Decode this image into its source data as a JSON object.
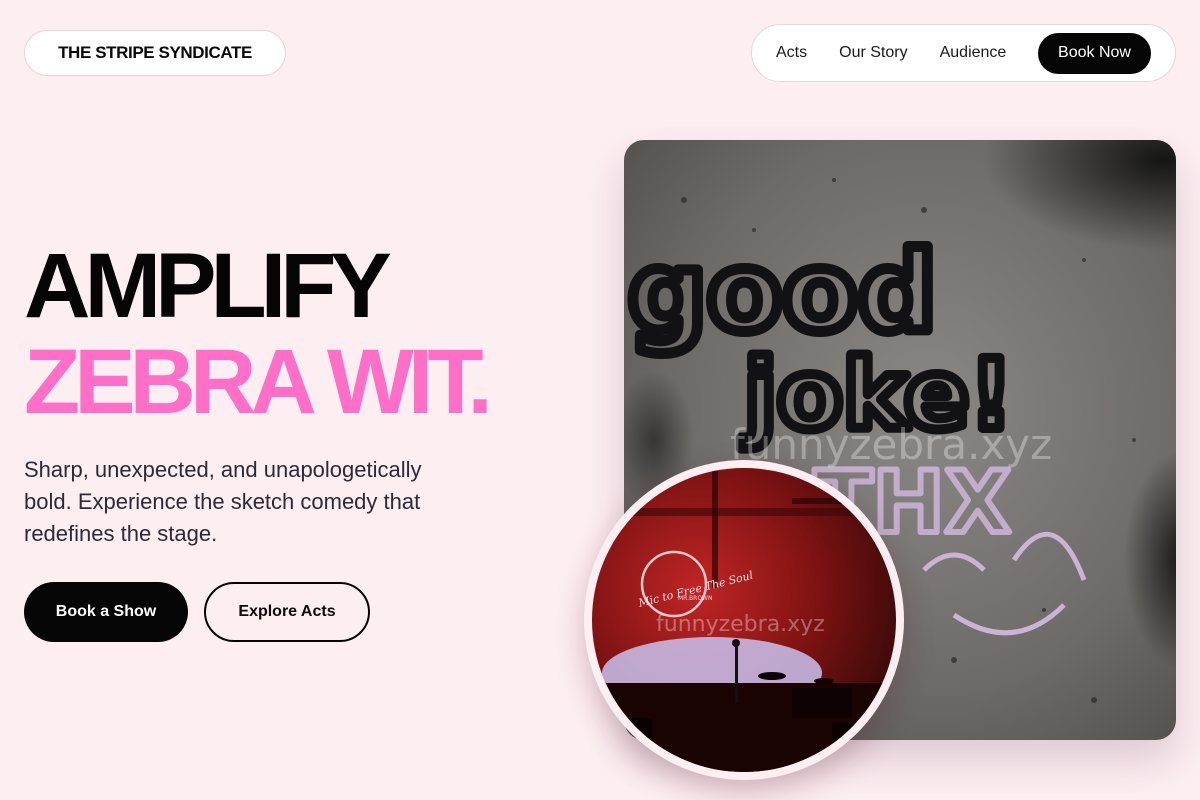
{
  "header": {
    "brand": "THE STRIPE SYNDICATE",
    "nav": [
      "Acts",
      "Our Story",
      "Audience"
    ],
    "cta": "Book Now"
  },
  "hero": {
    "line1": "AMPLIFY",
    "line2": "ZEBRA WIT.",
    "lead": "Sharp, unexpected, and unapologetically bold. Experience the sketch comedy that redefines the stage.",
    "primary_cta": "Book a Show",
    "secondary_cta": "Explore Acts"
  },
  "media": {
    "graffiti_text": [
      "good",
      "joke!",
      "THX"
    ],
    "watermark": "funnyzebra.xyz",
    "neon_text": "Mic to Free The Soul",
    "neon_subtext": "MR.BROWN",
    "stage_watermark": "funnyzebra.xyz"
  },
  "colors": {
    "background": "#fdeef2",
    "accent": "#ff6ec7",
    "dark": "#050505"
  }
}
